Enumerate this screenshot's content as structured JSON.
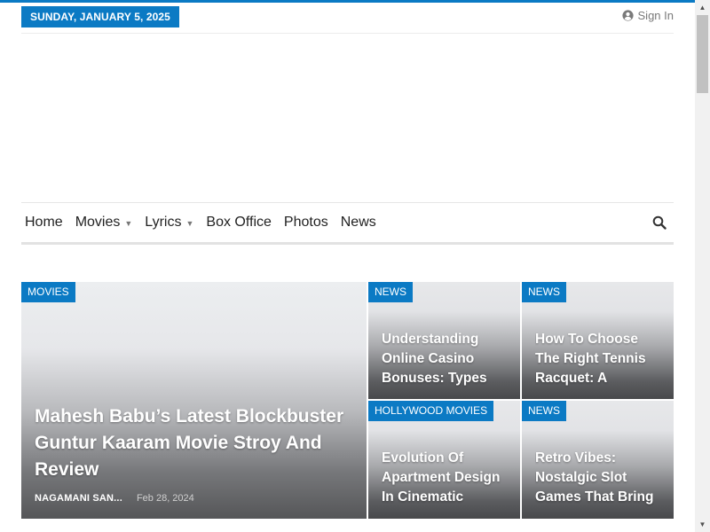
{
  "topbar": {
    "date": "SUNDAY, JANUARY 5, 2025",
    "signin_label": "Sign In"
  },
  "nav": {
    "items": [
      {
        "label": "Home",
        "has_caret": false
      },
      {
        "label": "Movies",
        "has_caret": true
      },
      {
        "label": "Lyrics",
        "has_caret": true
      },
      {
        "label": "Box Office",
        "has_caret": false
      },
      {
        "label": "Photos",
        "has_caret": false
      },
      {
        "label": "News",
        "has_caret": false
      }
    ],
    "search_icon": "search-icon"
  },
  "featured": {
    "category": "MOVIES",
    "title": "Mahesh Babu’s Latest Blockbuster Guntur Kaaram Movie Stroy And Review",
    "author": "NAGAMANI SAN...",
    "date": "Feb 28, 2024"
  },
  "cards": [
    {
      "category": "NEWS",
      "title": "Understanding Online Casino Bonuses: Types"
    },
    {
      "category": "NEWS",
      "title": "How To Choose The Right Tennis Racquet: A"
    },
    {
      "category": "HOLLYWOOD MOVIES",
      "title": "Evolution Of Apartment Design In Cinematic"
    },
    {
      "category": "NEWS",
      "title": "Retro Vibes: Nostalgic Slot Games That Bring"
    }
  ],
  "colors": {
    "accent": "#0b7ac4"
  }
}
